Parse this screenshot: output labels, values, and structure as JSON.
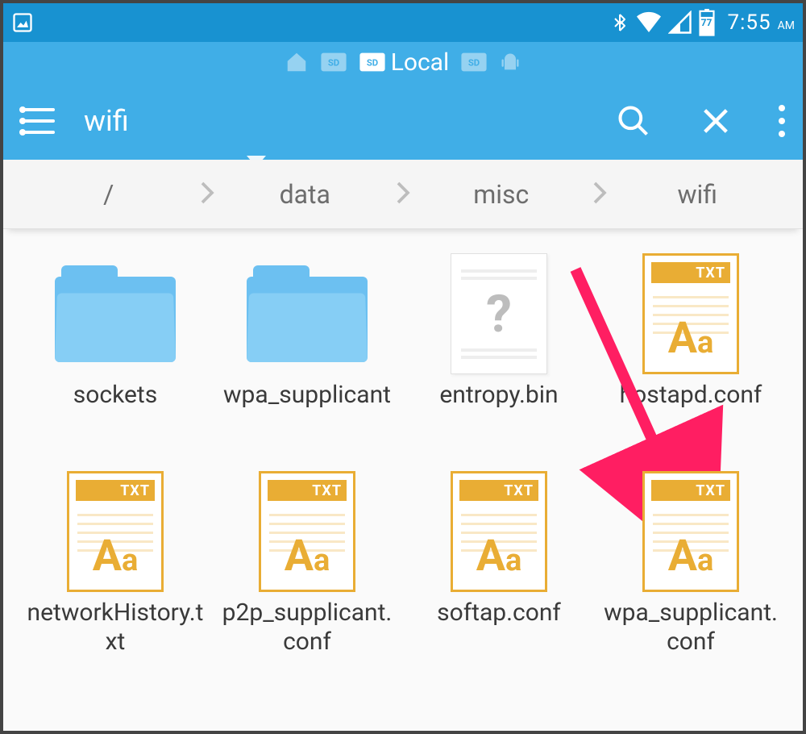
{
  "statusbar": {
    "battery_pct": "77",
    "time": "7:55",
    "ampm": "AM"
  },
  "tabs": {
    "current_label": "Local"
  },
  "appbar": {
    "search_value": "wifi"
  },
  "breadcrumb": [
    "/",
    "data",
    "misc",
    "wifi"
  ],
  "files": [
    {
      "name": "sockets",
      "type": "folder"
    },
    {
      "name": "wpa_supplicant",
      "type": "folder"
    },
    {
      "name": "entropy.bin",
      "type": "bin"
    },
    {
      "name": "hostapd.conf",
      "type": "txt"
    },
    {
      "name": "networkHistory.txt",
      "type": "txt"
    },
    {
      "name": "p2p_supplicant.conf",
      "type": "txt"
    },
    {
      "name": "softap.conf",
      "type": "txt"
    },
    {
      "name": "wpa_supplicant.conf",
      "type": "txt"
    }
  ],
  "txt_badge": "TXT",
  "annotation": {
    "points_to": "wpa_supplicant.conf"
  }
}
